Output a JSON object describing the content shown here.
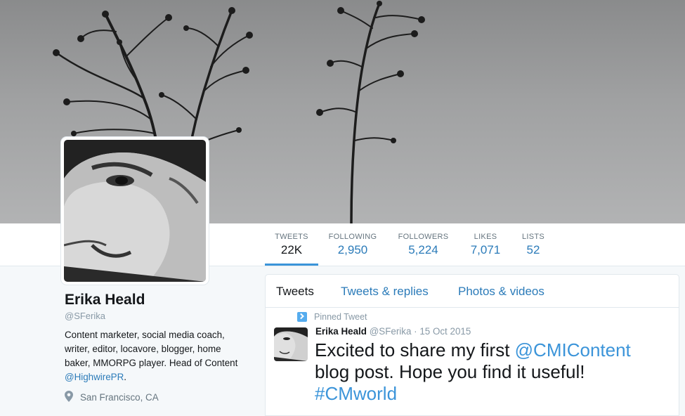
{
  "profile": {
    "name": "Erika Heald",
    "handle": "@SFerika",
    "bio_text": "Content marketer, social media coach, writer, editor, locavore, blogger, home baker, MMORPG player. Head of Content ",
    "bio_link": "@HighwirePR",
    "bio_end": ".",
    "location": "San Francisco, CA"
  },
  "stats": [
    {
      "label": "TWEETS",
      "value": "22K"
    },
    {
      "label": "FOLLOWING",
      "value": "2,950"
    },
    {
      "label": "FOLLOWERS",
      "value": "5,224"
    },
    {
      "label": "LIKES",
      "value": "7,071"
    },
    {
      "label": "LISTS",
      "value": "52"
    }
  ],
  "tabs": [
    "Tweets",
    "Tweets & replies",
    "Photos & videos"
  ],
  "tweet": {
    "pinned_label": "Pinned Tweet",
    "name": "Erika Heald",
    "handle": "@SFerika",
    "sep": " · ",
    "date": "15 Oct 2015",
    "text_1": "Excited to share my first ",
    "mention": "@CMIContent",
    "text_2": " blog post. Hope you find it useful! ",
    "hashtag": "#CMworld"
  },
  "colors": {
    "link": "#2b7bb9",
    "accent": "#3b94d9",
    "pinned": "#55acee"
  }
}
